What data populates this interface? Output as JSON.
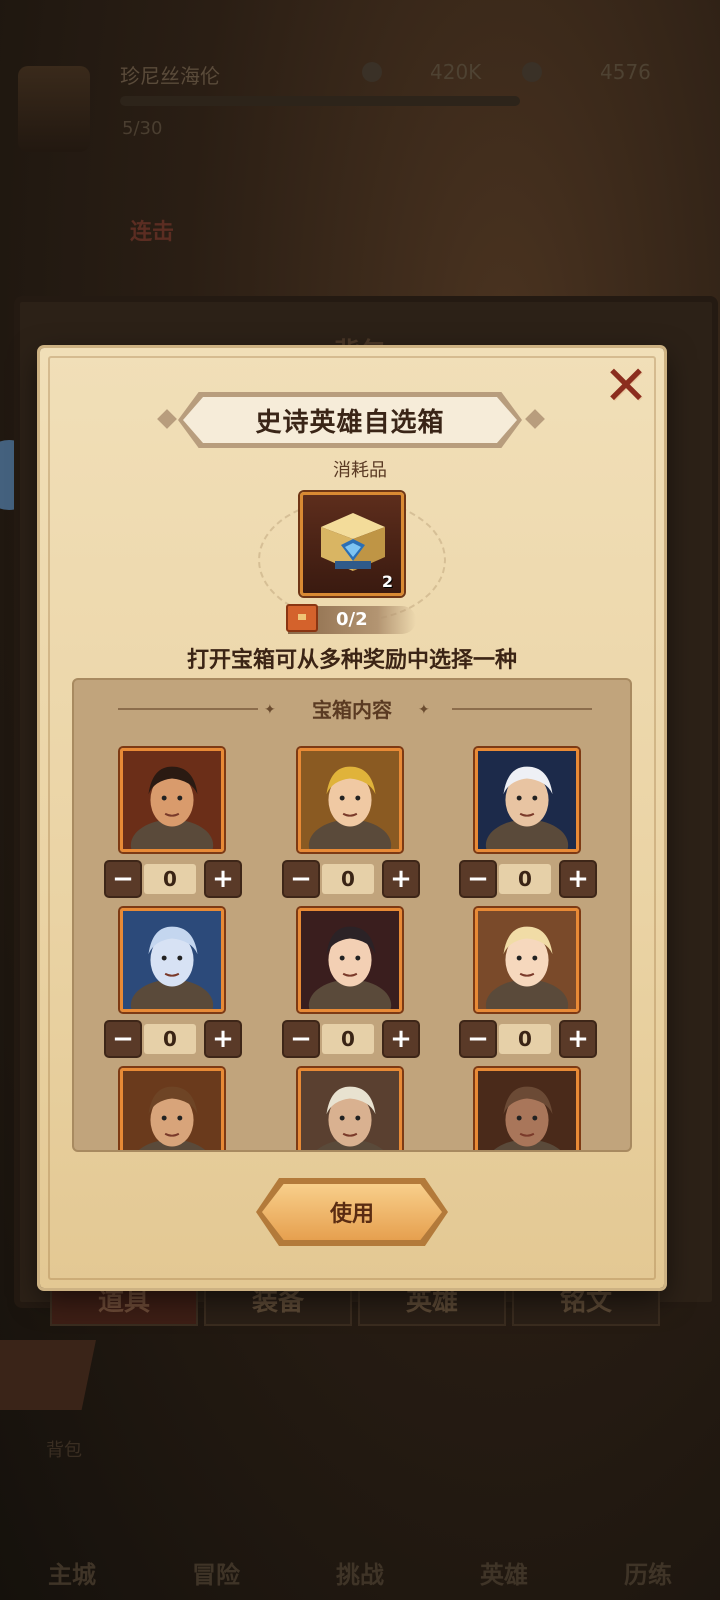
{
  "background": {
    "player_name": "珍尼丝海伦",
    "resource_gold": "420K",
    "resource_gems": "4576",
    "level_text": "5/30",
    "combo_text": "连击",
    "board_title": "背包",
    "tabs": [
      {
        "label": "道具",
        "active": true
      },
      {
        "label": "装备",
        "active": false
      },
      {
        "label": "英雄",
        "active": false
      },
      {
        "label": "铭文",
        "active": false
      }
    ],
    "back_label": "背包",
    "nav": [
      "主城",
      "冒险",
      "挑战",
      "英雄",
      "历练"
    ]
  },
  "dialog": {
    "title": "史诗英雄自选箱",
    "category": "消耗品",
    "item_count": "2",
    "progress": "0/2",
    "description": "打开宝箱可从多种奖励中选择一种",
    "contents_title": "宝箱内容",
    "use_label": "使用",
    "close_icon": "close-icon",
    "heroes": [
      {
        "name": "mustache-warrior",
        "value": "0",
        "bg": "#6b2e18",
        "skin": "#d99b6c",
        "hair": "#2a1a12"
      },
      {
        "name": "blonde-knight",
        "value": "0",
        "bg": "#8a5a22",
        "skin": "#f0c9a3",
        "hair": "#e0b33a"
      },
      {
        "name": "wizard",
        "value": "0",
        "bg": "#1c2a4a",
        "skin": "#e8c4a2",
        "hair": "#eef0f5"
      },
      {
        "name": "ice-queen",
        "value": "0",
        "bg": "#2c4a7a",
        "skin": "#d7e2f4",
        "hair": "#c4d6ef"
      },
      {
        "name": "nun",
        "value": "0",
        "bg": "#3a1e1e",
        "skin": "#f3d0b4",
        "hair": "#2b2226"
      },
      {
        "name": "blonde-mage",
        "value": "0",
        "bg": "#7a4a2a",
        "skin": "#f6d8bd",
        "hair": "#f1dca6"
      },
      {
        "name": "cowboy",
        "value": "",
        "bg": "#6a3a1c",
        "skin": "#d8a47a",
        "hair": "#6e4425"
      },
      {
        "name": "hooded-hero",
        "value": "",
        "bg": "#5a4030",
        "skin": "#d9b190",
        "hair": "#e8e2d0"
      },
      {
        "name": "minotaur",
        "value": "",
        "bg": "#4a2a1a",
        "skin": "#a9765a",
        "hair": "#6b4a35"
      }
    ]
  }
}
